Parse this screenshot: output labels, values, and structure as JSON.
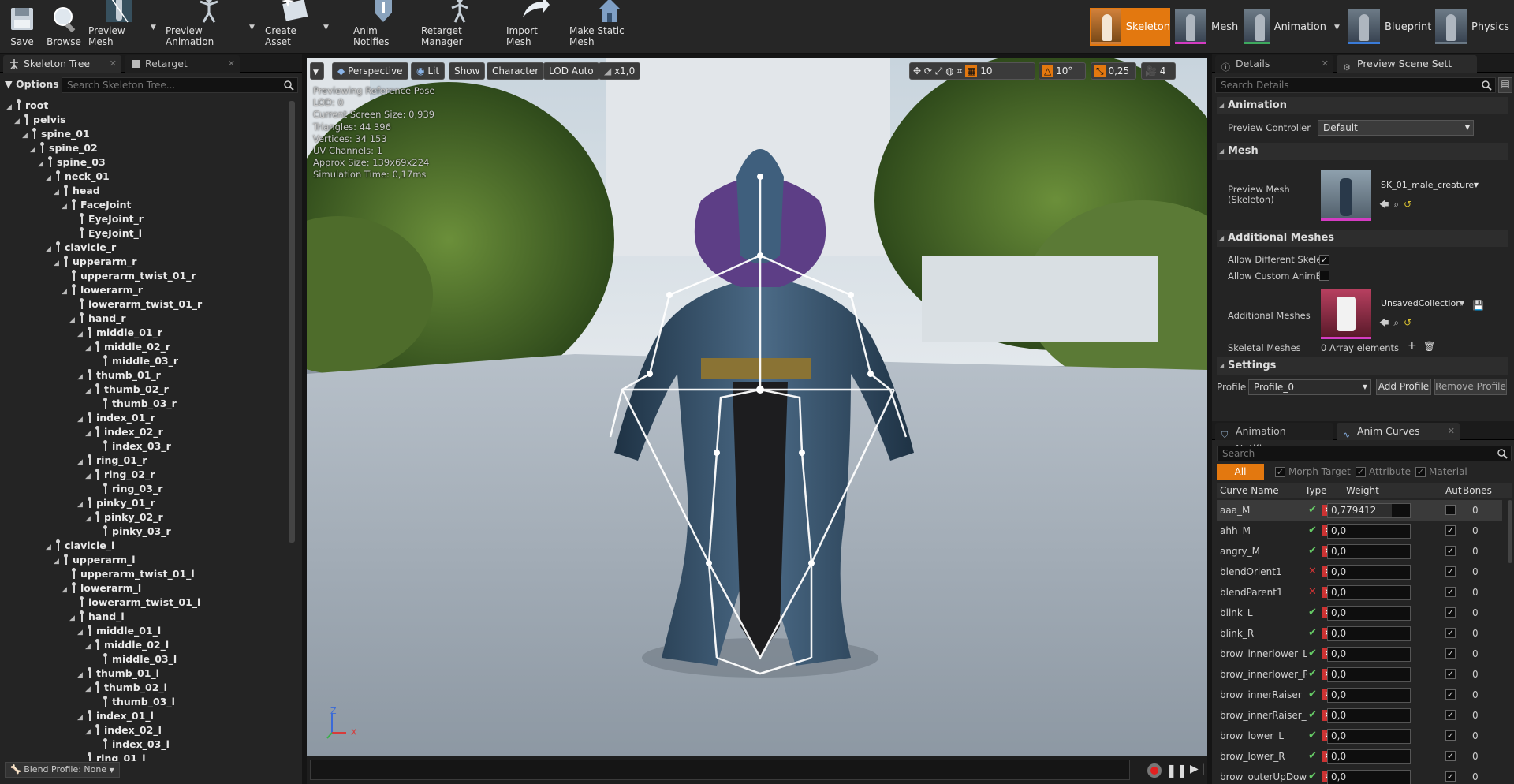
{
  "toolbar": {
    "left_buttons": [
      "Save",
      "Browse",
      "Preview Mesh",
      "Preview Animation",
      "Create Asset"
    ],
    "mid_buttons": [
      "Anim Notifies",
      "Retarget Manager",
      "Import Mesh",
      "Make Static Mesh"
    ],
    "modes": [
      "Skeleton",
      "Mesh",
      "Animation",
      "Blueprint",
      "Physics"
    ]
  },
  "left": {
    "tabs": [
      "Skeleton Tree",
      "Retarget Manager"
    ],
    "options_label": "Options",
    "search_placeholder": "Search Skeleton Tree...",
    "blend_profile": "Blend Profile: None",
    "tree": [
      {
        "label": "root",
        "depth": 0
      },
      {
        "label": "pelvis",
        "depth": 1
      },
      {
        "label": "spine_01",
        "depth": 2
      },
      {
        "label": "spine_02",
        "depth": 3
      },
      {
        "label": "spine_03",
        "depth": 4
      },
      {
        "label": "neck_01",
        "depth": 5
      },
      {
        "label": "head",
        "depth": 6
      },
      {
        "label": "FaceJoint",
        "depth": 7
      },
      {
        "label": "EyeJoint_r",
        "depth": 8
      },
      {
        "label": "EyeJoint_l",
        "depth": 8
      },
      {
        "label": "clavicle_r",
        "depth": 5
      },
      {
        "label": "upperarm_r",
        "depth": 6
      },
      {
        "label": "upperarm_twist_01_r",
        "depth": 7
      },
      {
        "label": "lowerarm_r",
        "depth": 7
      },
      {
        "label": "lowerarm_twist_01_r",
        "depth": 8
      },
      {
        "label": "hand_r",
        "depth": 8
      },
      {
        "label": "middle_01_r",
        "depth": 9
      },
      {
        "label": "middle_02_r",
        "depth": 10
      },
      {
        "label": "middle_03_r",
        "depth": 11
      },
      {
        "label": "thumb_01_r",
        "depth": 9
      },
      {
        "label": "thumb_02_r",
        "depth": 10
      },
      {
        "label": "thumb_03_r",
        "depth": 11
      },
      {
        "label": "index_01_r",
        "depth": 9
      },
      {
        "label": "index_02_r",
        "depth": 10
      },
      {
        "label": "index_03_r",
        "depth": 11
      },
      {
        "label": "ring_01_r",
        "depth": 9
      },
      {
        "label": "ring_02_r",
        "depth": 10
      },
      {
        "label": "ring_03_r",
        "depth": 11
      },
      {
        "label": "pinky_01_r",
        "depth": 9
      },
      {
        "label": "pinky_02_r",
        "depth": 10
      },
      {
        "label": "pinky_03_r",
        "depth": 11
      },
      {
        "label": "clavicle_l",
        "depth": 5
      },
      {
        "label": "upperarm_l",
        "depth": 6
      },
      {
        "label": "upperarm_twist_01_l",
        "depth": 7
      },
      {
        "label": "lowerarm_l",
        "depth": 7
      },
      {
        "label": "lowerarm_twist_01_l",
        "depth": 8
      },
      {
        "label": "hand_l",
        "depth": 8
      },
      {
        "label": "middle_01_l",
        "depth": 9
      },
      {
        "label": "middle_02_l",
        "depth": 10
      },
      {
        "label": "middle_03_l",
        "depth": 11
      },
      {
        "label": "thumb_01_l",
        "depth": 9
      },
      {
        "label": "thumb_02_l",
        "depth": 10
      },
      {
        "label": "thumb_03_l",
        "depth": 11
      },
      {
        "label": "index_01_l",
        "depth": 9
      },
      {
        "label": "index_02_l",
        "depth": 10
      },
      {
        "label": "index_03_l",
        "depth": 11
      },
      {
        "label": "ring_01_l",
        "depth": 9
      }
    ]
  },
  "viewport": {
    "buttons": {
      "perspective": "Perspective",
      "lit": "Lit",
      "show": "Show",
      "character": "Character",
      "lod": "LOD Auto",
      "speed": "x1,0"
    },
    "right_controls": {
      "grid": "10",
      "angle": "10°",
      "scale": "0,25",
      "cam": "4"
    },
    "stats": [
      "Previewing Reference Pose",
      "LOD: 0",
      "Current Screen Size: 0,939",
      "Triangles: 44 396",
      "Vertices: 34 153",
      "UV Channels: 1",
      "Approx Size: 139x69x224",
      "Simulation Time: 0,17ms"
    ],
    "axis_x": "X",
    "axis_z": "Z"
  },
  "right": {
    "tabs": [
      "Details",
      "Preview Scene Sett"
    ],
    "search_placeholder": "Search Details",
    "sections": {
      "animation": "Animation",
      "mesh": "Mesh",
      "additional": "Additional Meshes",
      "settings": "Settings"
    },
    "preview_controller_label": "Preview Controller",
    "preview_controller_value": "Default",
    "preview_mesh_label": "Preview Mesh (Skeleton)",
    "preview_mesh_value": "SK_01_male_creature",
    "allow_diff_label": "Allow Different Skelet",
    "allow_custom_label": "Allow Custom AnimBl",
    "additional_meshes_label": "Additional Meshes",
    "additional_meshes_value": "UnsavedCollection",
    "skeletal_meshes_label": "Skeletal Meshes",
    "skeletal_meshes_value": "0 Array elements",
    "profile_label": "Profile",
    "profile_value": "Profile_0",
    "add_profile": "Add Profile",
    "remove_profile": "Remove Profile",
    "bottom_tabs": [
      "Animation Notifies",
      "Anim Curves"
    ],
    "curve_search": "Search",
    "filters": [
      "All Curves",
      "Morph Target",
      "Attribute",
      "Material"
    ],
    "columns": [
      "Curve Name",
      "Type",
      "Weight",
      "Aut",
      "Bones"
    ],
    "curves": [
      {
        "name": "aaa_M",
        "weight": "0,779412",
        "auto": false,
        "bones": "0",
        "fill": 0.779412
      },
      {
        "name": "ahh_M",
        "weight": "0,0",
        "auto": true,
        "bones": "0",
        "fill": 0
      },
      {
        "name": "angry_M",
        "weight": "0,0",
        "auto": true,
        "bones": "0",
        "fill": 0
      },
      {
        "name": "blendOrient1",
        "weight": "0,0",
        "auto": true,
        "bones": "0",
        "fill": 0
      },
      {
        "name": "blendParent1",
        "weight": "0,0",
        "auto": true,
        "bones": "0",
        "fill": 0
      },
      {
        "name": "blink_L",
        "weight": "0,0",
        "auto": true,
        "bones": "0",
        "fill": 0
      },
      {
        "name": "blink_R",
        "weight": "0,0",
        "auto": true,
        "bones": "0",
        "fill": 0
      },
      {
        "name": "brow_innerlower_L",
        "weight": "0,0",
        "auto": true,
        "bones": "0",
        "fill": 0
      },
      {
        "name": "brow_innerlower_R",
        "weight": "0,0",
        "auto": true,
        "bones": "0",
        "fill": 0
      },
      {
        "name": "brow_innerRaiser_L",
        "weight": "0,0",
        "auto": true,
        "bones": "0",
        "fill": 0
      },
      {
        "name": "brow_innerRaiser_R",
        "weight": "0,0",
        "auto": true,
        "bones": "0",
        "fill": 0
      },
      {
        "name": "brow_lower_L",
        "weight": "0,0",
        "auto": true,
        "bones": "0",
        "fill": 0
      },
      {
        "name": "brow_lower_R",
        "weight": "0,0",
        "auto": true,
        "bones": "0",
        "fill": 0
      },
      {
        "name": "brow_outerUpDown",
        "weight": "0,0",
        "auto": true,
        "bones": "0",
        "fill": 0
      }
    ]
  }
}
